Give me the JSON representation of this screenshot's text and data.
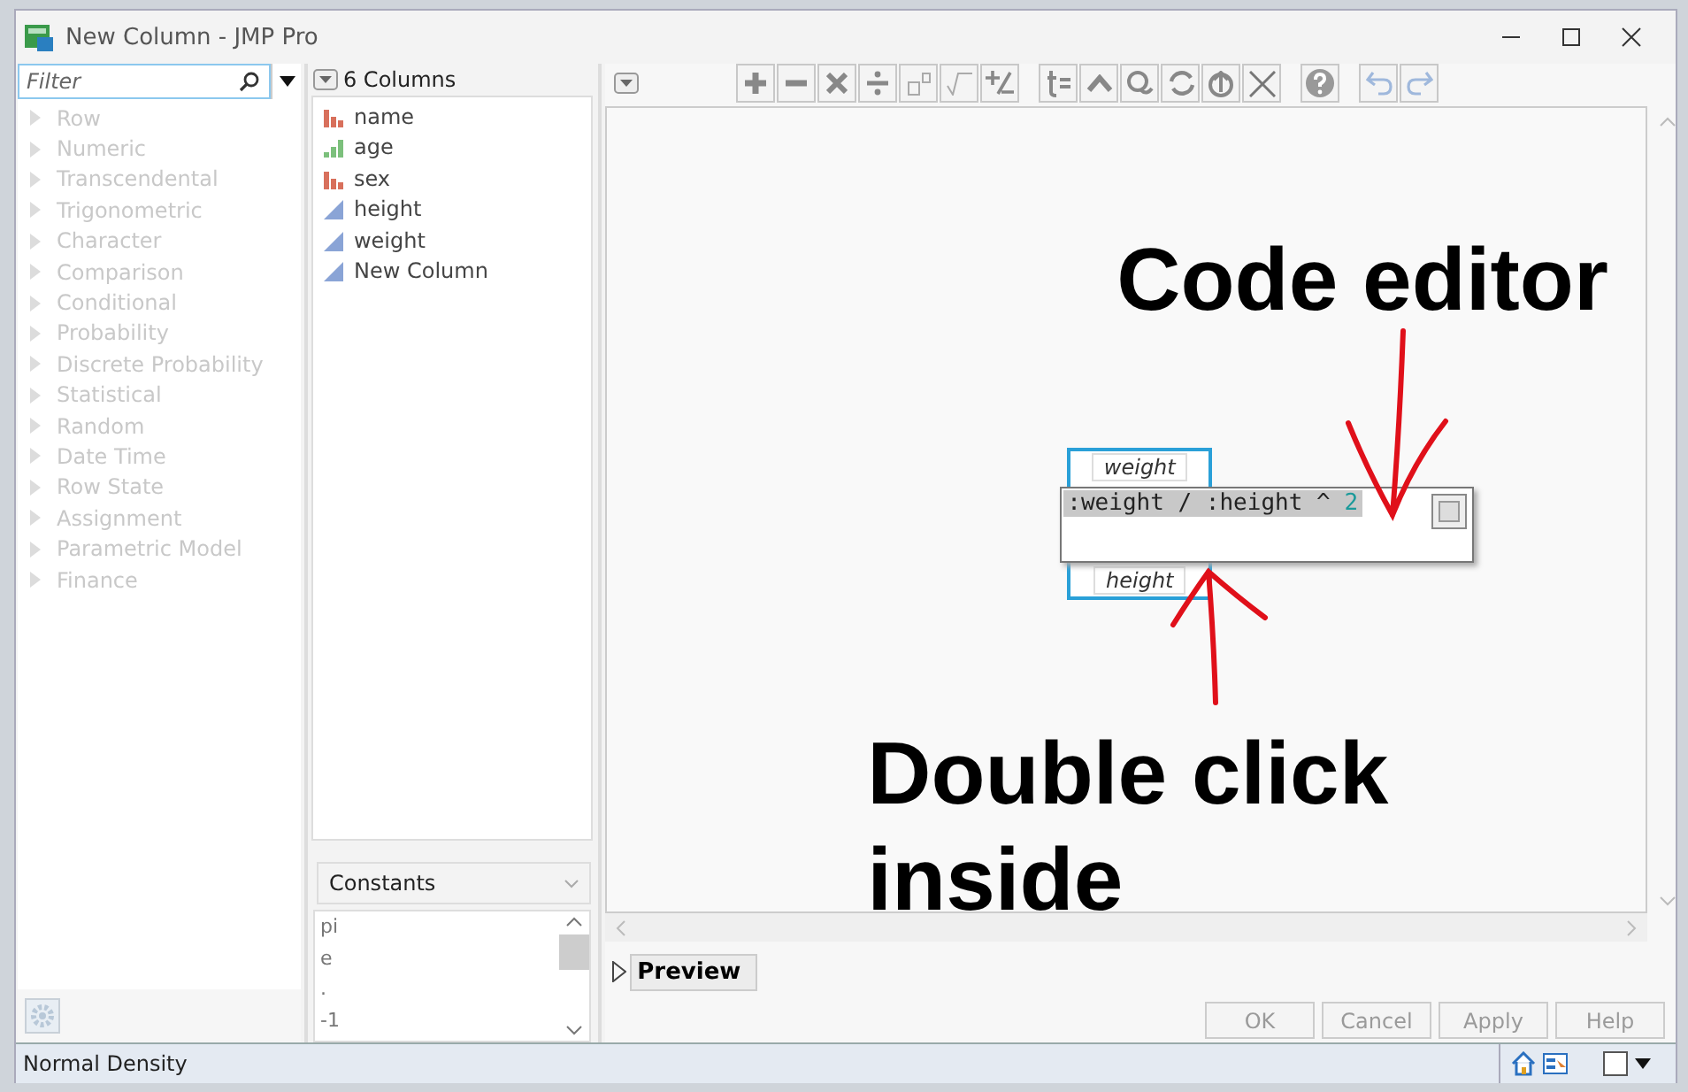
{
  "window": {
    "title": "New Column - JMP Pro"
  },
  "functions": {
    "filter": {
      "placeholder": "Filter"
    },
    "categories": [
      {
        "label": "Row",
        "disabled": true
      },
      {
        "label": "Numeric",
        "disabled": true
      },
      {
        "label": "Transcendental",
        "disabled": true
      },
      {
        "label": "Trigonometric",
        "disabled": true
      },
      {
        "label": "Character",
        "disabled": true
      },
      {
        "label": "Comparison",
        "disabled": true
      },
      {
        "label": "Conditional",
        "disabled": true
      },
      {
        "label": "Probability",
        "disabled": true
      },
      {
        "label": "Discrete Probability",
        "disabled": true
      },
      {
        "label": "Statistical",
        "disabled": true
      },
      {
        "label": "Random",
        "disabled": true
      },
      {
        "label": "Date Time",
        "disabled": true
      },
      {
        "label": "Row State",
        "disabled": true
      },
      {
        "label": "Assignment",
        "disabled": true
      },
      {
        "label": "Parametric Model",
        "disabled": true
      },
      {
        "label": "Finance",
        "disabled": true
      }
    ]
  },
  "columns": {
    "header": "6 Columns",
    "items": [
      {
        "name": "name",
        "kind": "nominal"
      },
      {
        "name": "age",
        "kind": "ordinal"
      },
      {
        "name": "sex",
        "kind": "nominal"
      },
      {
        "name": "height",
        "kind": "continuous"
      },
      {
        "name": "weight",
        "kind": "continuous"
      },
      {
        "name": "New Column",
        "kind": "continuous"
      }
    ]
  },
  "constants": {
    "dropdown": "Constants",
    "items": [
      "pi",
      "e",
      ".",
      "-1"
    ]
  },
  "editor": {
    "formula": {
      "numerator": "weight",
      "denominator": "height"
    },
    "code": {
      "text": ":weight / :height ^",
      "exponent": "2"
    }
  },
  "annotations": [
    {
      "text": "Code editor"
    },
    {
      "text": "Double click inside"
    }
  ],
  "preview": {
    "label": "Preview",
    "expanded": false
  },
  "buttons": [
    {
      "label": "OK",
      "disabled": true
    },
    {
      "label": "Cancel",
      "disabled": true
    },
    {
      "label": "Apply",
      "disabled": true
    },
    {
      "label": "Help",
      "disabled": true
    }
  ],
  "status_bar": {
    "text": "Normal Density"
  }
}
